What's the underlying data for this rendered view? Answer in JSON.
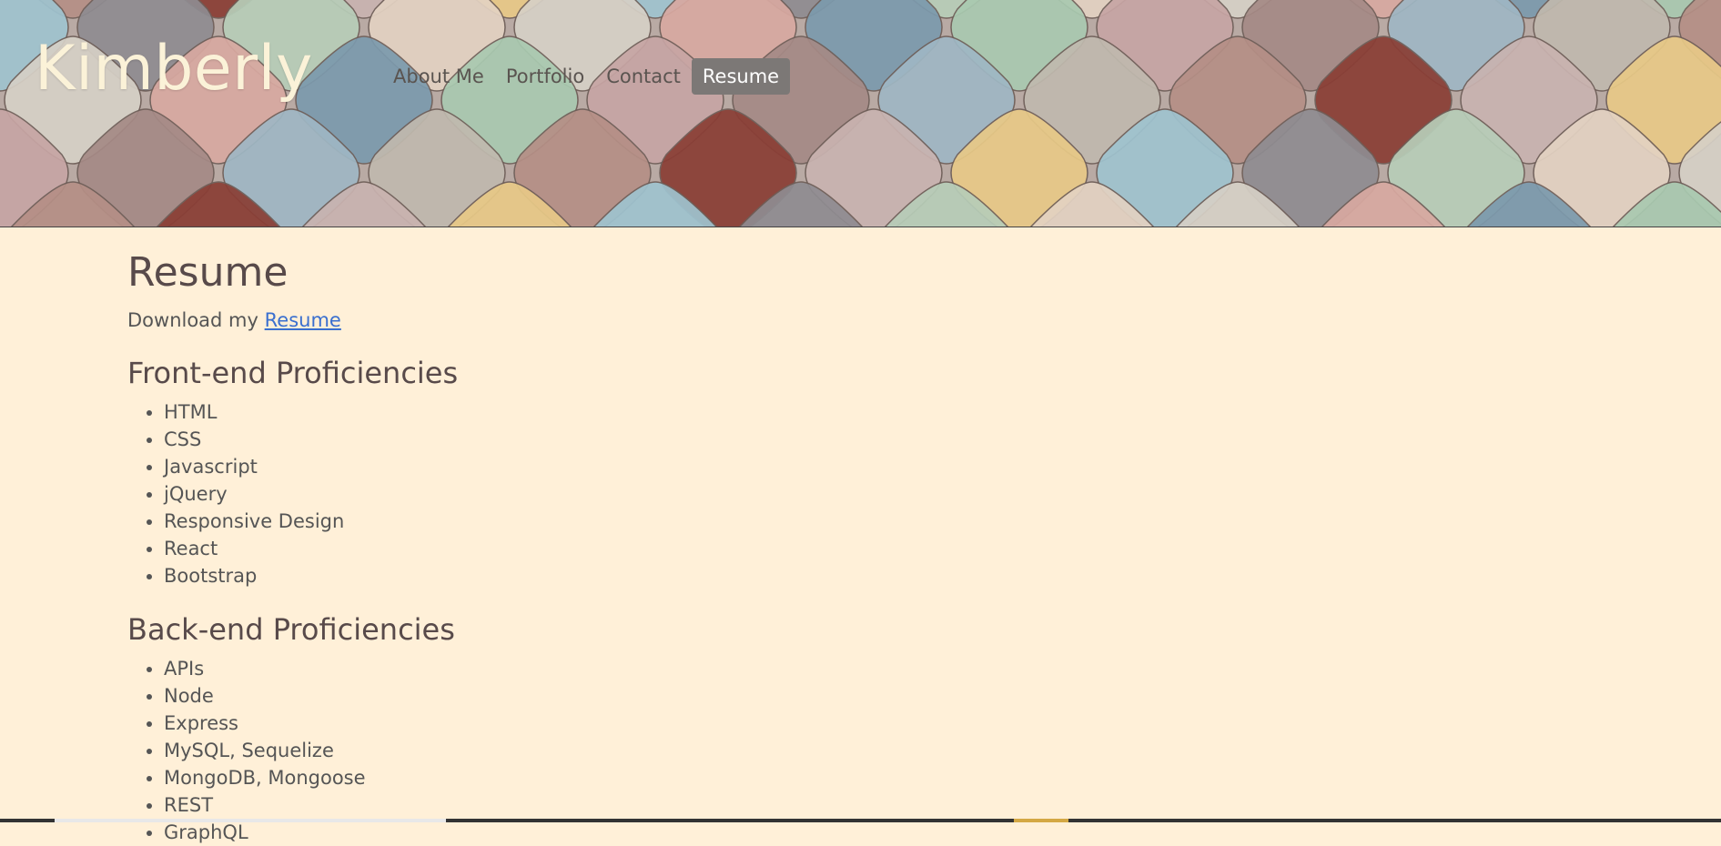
{
  "header": {
    "brand": "Kimberly",
    "nav": [
      {
        "label": "About Me",
        "active": false
      },
      {
        "label": "Portfolio",
        "active": false
      },
      {
        "label": "Contact",
        "active": false
      },
      {
        "label": "Resume",
        "active": true
      }
    ]
  },
  "main": {
    "title": "Resume",
    "download_prefix": "Download my",
    "download_link": "Resume",
    "sections": [
      {
        "title": "Front-end Proficiencies",
        "items": [
          "HTML",
          "CSS",
          "Javascript",
          "jQuery",
          "Responsive Design",
          "React",
          "Bootstrap"
        ]
      },
      {
        "title": "Back-end Proficiencies",
        "items": [
          "APIs",
          "Node",
          "Express",
          "MySQL, Sequelize",
          "MongoDB, Mongoose",
          "REST",
          "GraphQL"
        ]
      }
    ]
  },
  "colors": {
    "background": "#fff0d8",
    "brand": "#fbf2d8",
    "nav_active_bg": "#7c7876",
    "link": "#3a6fcf"
  }
}
